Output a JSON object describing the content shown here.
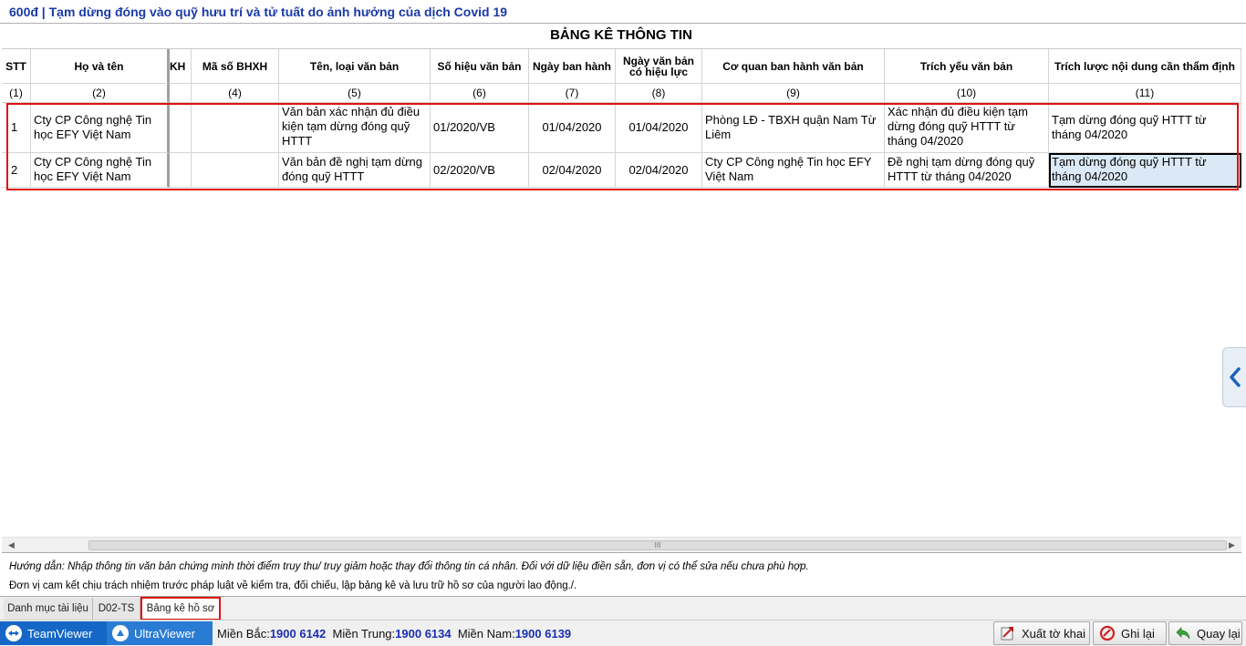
{
  "form": {
    "title": "600đ | Tạm dừng đóng vào quỹ hưu trí và tử tuất do ảnh hưởng của dịch Covid 19",
    "sheet_title": "BẢNG KÊ THÔNG TIN"
  },
  "grid": {
    "headers": {
      "stt": "STT",
      "ho_ten": "Họ và tên",
      "clipped": "KH",
      "ma_so": "Mã số BHXH",
      "ten_loai": "Tên, loại văn bản",
      "so_hieu": "Số hiệu văn bản",
      "ngay_ban_hanh": "Ngày ban hành",
      "ngay_hieu_luc_1": "Ngày văn bản",
      "ngay_hieu_luc_2": "có hiệu lực",
      "co_quan": "Cơ quan ban hành văn bản",
      "trich_yeu": "Trích yếu văn bản",
      "trich_luoc": "Trích lược nội dung cần thẩm định"
    },
    "col_numbers": [
      "(1)",
      "(2)",
      "",
      "(4)",
      "(5)",
      "(6)",
      "(7)",
      "(8)",
      "(9)",
      "(10)",
      "(11)"
    ],
    "rows": [
      {
        "stt": "1",
        "ho_ten": "Cty CP Công nghệ Tin học EFY Việt Nam",
        "clipped": "",
        "ma_so": "",
        "ten_loai": "Văn bản xác nhận đủ điều kiện tạm dừng đóng quỹ HTTT",
        "so_hieu": "01/2020/VB",
        "ngay_ban_hanh": "01/04/2020",
        "ngay_hieu_luc": "01/04/2020",
        "co_quan": "Phòng LĐ - TBXH quận Nam Từ Liêm",
        "trich_yeu": "Xác nhận đủ điều kiện tạm dừng đóng quỹ HTTT từ tháng 04/2020",
        "trich_luoc": "Tạm dừng đóng quỹ HTTT từ tháng 04/2020"
      },
      {
        "stt": "2",
        "ho_ten": "Cty CP Công nghệ Tin học EFY Việt Nam",
        "clipped": "",
        "ma_so": "",
        "ten_loai": "Văn bản đề nghị tạm dừng đóng quỹ HTTT",
        "so_hieu": "02/2020/VB",
        "ngay_ban_hanh": "02/04/2020",
        "ngay_hieu_luc": "02/04/2020",
        "co_quan": "Cty CP Công nghệ Tin học EFY Việt Nam",
        "trich_yeu": "Đề nghị tạm dừng đóng quỹ HTTT từ tháng 04/2020",
        "trich_luoc": "Tạm dừng đóng quỹ HTTT từ tháng 04/2020"
      }
    ]
  },
  "scrollbar": {
    "grip": "III"
  },
  "guide": {
    "line1": "Hướng dẫn: Nhập thông tin văn bản chứng minh thời điểm truy thu/ truy giảm hoặc thay đổi thông tin cá nhân. Đối với dữ liệu điền sẵn, đơn vị có thể sửa nếu chưa phù hợp.",
    "line2": "Đơn vị cam kết chịu trách nhiệm trước pháp luật về kiểm tra, đối chiếu, lập bảng kê và lưu trữ hồ sơ của người lao động./."
  },
  "tabs": [
    {
      "label": "Danh mục tài liệu"
    },
    {
      "label": "D02-TS"
    },
    {
      "label": "Bảng kê hồ sơ"
    }
  ],
  "status": {
    "teamviewer": "TeamViewer",
    "ultraviewer": "UltraViewer",
    "mien_bac_label": "Miền Bắc:",
    "mien_bac_phone": "1900 6142",
    "mien_trung_label": "Miền Trung:",
    "mien_trung_phone": "1900 6134",
    "mien_nam_label": "Miền Nam:",
    "mien_nam_phone": "1900 6139"
  },
  "buttons": {
    "export": "Xuất tờ khai",
    "save": "Ghi lại",
    "back": "Quay lại"
  },
  "colors": {
    "title_blue": "#1a3aa8",
    "highlight_red": "#e01010",
    "selected_cell": "#dbe9f6",
    "taskbar_blue": "#1567c6"
  }
}
